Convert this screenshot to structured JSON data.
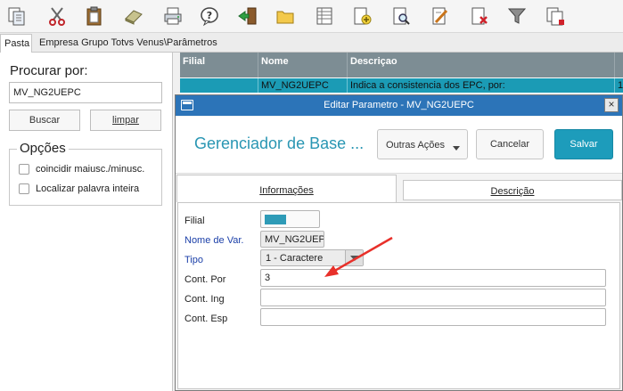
{
  "toolbar": {
    "buttons": [
      {
        "name": "copy",
        "icon": "copy-document-icon"
      },
      {
        "name": "cut",
        "icon": "scissors-icon"
      },
      {
        "name": "paste",
        "icon": "clipboard-icon"
      },
      {
        "name": "erase",
        "icon": "eraser-icon"
      },
      {
        "name": "print",
        "icon": "printer-icon"
      },
      {
        "name": "help",
        "icon": "help-question-icon"
      },
      {
        "name": "exit",
        "icon": "exit-door-icon"
      },
      {
        "name": "open",
        "icon": "folder-icon"
      },
      {
        "name": "list",
        "icon": "table-list-icon"
      },
      {
        "name": "new",
        "icon": "add-document-icon"
      },
      {
        "name": "view",
        "icon": "magnify-document-icon"
      },
      {
        "name": "edit",
        "icon": "edit-document-icon"
      },
      {
        "name": "delete",
        "icon": "delete-document-icon"
      },
      {
        "name": "filter",
        "icon": "funnel-filter-icon"
      },
      {
        "name": "copy-record",
        "icon": "copy-record-icon"
      }
    ]
  },
  "tabs": {
    "pasta": "Pasta",
    "breadcrumb": "Empresa Grupo Totvs Venus\\Parâmetros"
  },
  "search": {
    "label": "Procurar por:",
    "value": "MV_NG2UEPC",
    "buscar_label": "Buscar",
    "limpar_label": "limpar"
  },
  "options": {
    "title": "Opções",
    "items": [
      {
        "label": "coincidir maiusc./minusc.",
        "checked": false
      },
      {
        "label": "Localizar palavra inteira",
        "checked": false
      }
    ]
  },
  "grid": {
    "columns": [
      "Filial",
      "Nome",
      "Descriçao"
    ],
    "rows": [
      {
        "filial": "",
        "nome": "MV_NG2UEPC",
        "descricao": "Indica a consistencia dos EPC, por:",
        "extra": "1"
      }
    ]
  },
  "dialog": {
    "title": "Editar Parametro - MV_NG2UEPC",
    "heading": "Gerenciador de Base ...",
    "outras_acoes_label": "Outras Ações",
    "cancelar_label": "Cancelar",
    "salvar_label": "Salvar",
    "tab_info_label": "Informações",
    "tab_desc_label": "Descrição",
    "fields": {
      "filial_label": "Filial",
      "nomevar_label": "Nome de Var.",
      "nomevar_value": "MV_NG2UEP",
      "tipo_label": "Tipo",
      "tipo_value": "1 - Caractere",
      "contpor_label": "Cont. Por",
      "contpor_value": "3",
      "conting_label": "Cont. Ing",
      "conting_value": "",
      "contesp_label": "Cont. Esp",
      "contesp_value": ""
    }
  },
  "colors": {
    "accent": "#1d9cbb",
    "titlebar": "#2c74b8",
    "grid_header": "#7d8d94",
    "grid_selected_row": "#1b9bb5",
    "required_label": "#1b3fa8",
    "annotation_arrow": "#e8302a"
  }
}
